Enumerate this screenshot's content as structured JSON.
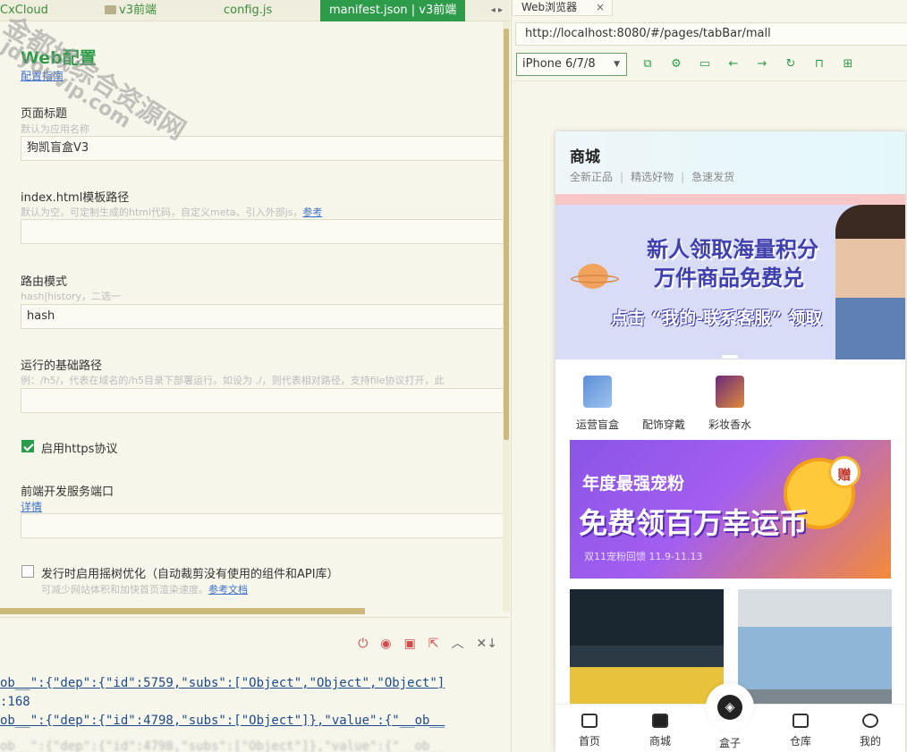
{
  "editor": {
    "tabs": [
      {
        "label": "CxCloud"
      },
      {
        "label": "v3前端"
      },
      {
        "label": "config.js"
      },
      {
        "label": "manifest.json | v3前端"
      }
    ],
    "tab_scroll_arrows": "◂ ▸",
    "section_title": "Web配置",
    "config_guide_link": "配置指南",
    "fields": {
      "page_title": {
        "label": "页面标题",
        "hint": "默认为应用名称",
        "value": "狗凯盲盒V3"
      },
      "template_path": {
        "label": "index.html模板路径",
        "hint": "默认为空，可定制生成的html代码，自定义meta、引入外部js，",
        "hint_link": "参考",
        "value": ""
      },
      "router_mode": {
        "label": "路由模式",
        "hint": "hash|history，二选一",
        "value": "hash"
      },
      "base_path": {
        "label": "运行的基础路径",
        "hint": "例：/h5/，代表在域名的/h5目录下部署运行。如设为 ./，则代表相对路径，支持file协议打开，此",
        "value": ""
      },
      "https": {
        "label": "启用https协议",
        "checked": true
      },
      "dev_port": {
        "label": "前端开发服务端口",
        "link": "详情",
        "value": ""
      },
      "tree_shaking": {
        "label": "发行时启用摇树优化（自动裁剪没有使用的组件和API库）",
        "hint": "可减少网站体积和加快首页渲染速度。",
        "hint_link": "参考文档",
        "checked": false
      }
    }
  },
  "console": {
    "tools": [
      "stop-icon",
      "record-icon",
      "clear-icon",
      "export-icon",
      "collapse-icon",
      "wrap-icon"
    ],
    "lines": [
      "ob__\":{\"dep\":{\"id\":5759,\"subs\":[\"Object\",\"Object\",\"Object\"]",
      ":168",
      "ob__\":{\"dep\":{\"id\":4798,\"subs\":[\"Object\"]},\"value\":{\"__ob__"
    ]
  },
  "browser": {
    "tab_label": "Web浏览器",
    "tab_close": "×",
    "url": "http://localhost:8080/#/pages/tabBar/mall",
    "device": "iPhone 6/7/8",
    "tool_icons": [
      "new-window-icon",
      "settings-icon",
      "console-icon",
      "back-icon",
      "forward-icon",
      "refresh-icon",
      "lock-icon",
      "grid-icon"
    ]
  },
  "phone": {
    "header_title": "商城",
    "header_sub": [
      "全新正品",
      "精选好物",
      "急速发货"
    ],
    "banner1": {
      "line1": "新人领取海量积分",
      "line2": "万件商品免费兑",
      "line3": "点击 “我的-联系客服” 领取"
    },
    "categories": [
      "运营盲盒",
      "配饰穿戴",
      "彩妆香水"
    ],
    "banner2": {
      "line1": "年度最强宠粉",
      "line2": "免费领百万幸运币",
      "line3": "双11宠粉回馈 11.9-11.13",
      "badge": "赠"
    },
    "tabbar": [
      "首页",
      "商城",
      "盒子",
      "仓库",
      "我的"
    ]
  },
  "watermark": {
    "line1": "金都城综合资源网",
    "line2": "jdyouvip.com"
  },
  "colors": {
    "accent": "#2e9b4a",
    "link": "#3d6fc9",
    "scroll_thumb": "#cdb979"
  }
}
